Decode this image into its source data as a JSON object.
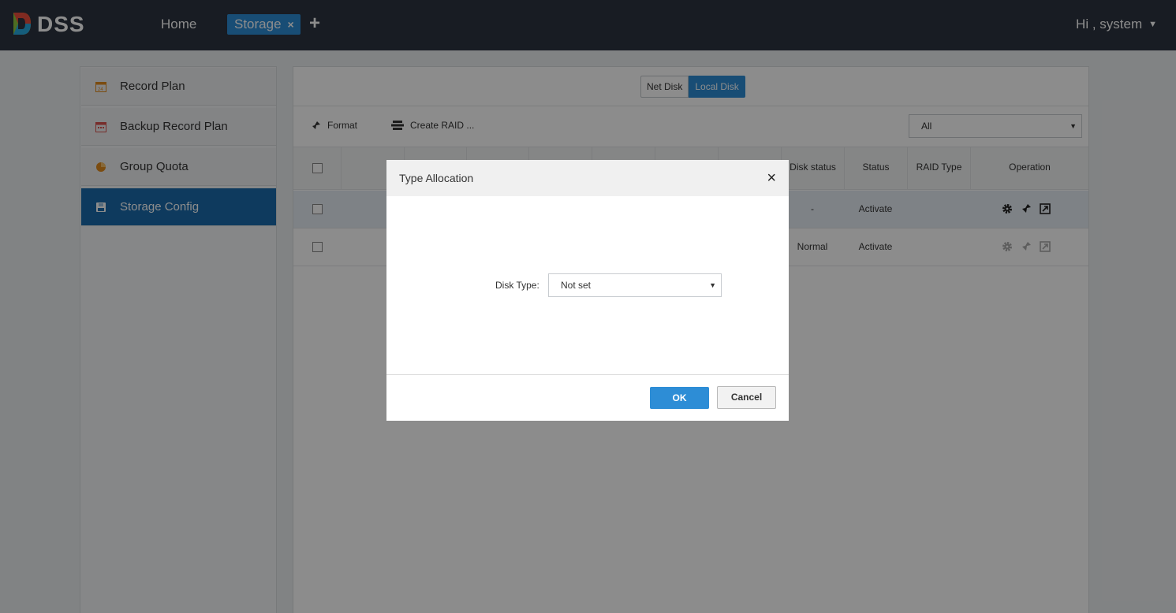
{
  "header": {
    "brand": "DSS",
    "tabs": {
      "home": "Home",
      "storage": "Storage"
    },
    "close_tab_glyph": "×",
    "add_tab_glyph": "+",
    "user_greeting": "Hi , system"
  },
  "sidebar": {
    "items": [
      {
        "label": "Record Plan",
        "icon": "calendar-24-icon"
      },
      {
        "label": "Backup Record Plan",
        "icon": "calendar-icon"
      },
      {
        "label": "Group Quota",
        "icon": "pie-chart-icon"
      },
      {
        "label": "Storage Config",
        "icon": "disk-icon",
        "active": true
      }
    ]
  },
  "main": {
    "disk_toggle": {
      "net": "Net Disk",
      "local": "Local Disk",
      "selected": "Local Disk"
    },
    "toolbar": {
      "format": "Format",
      "create_raid": "Create RAID ..."
    },
    "filter": {
      "value": "All"
    },
    "table": {
      "columns": [
        "",
        "",
        "",
        "",
        "",
        "",
        "",
        "",
        "Disk status",
        "Status",
        "RAID Type",
        "Operation"
      ],
      "rows": [
        {
          "disk_status": "-",
          "status": "Activate",
          "raid_type": "",
          "selected": true
        },
        {
          "disk_status": "Normal",
          "status": "Activate",
          "raid_type": "",
          "selected": false
        }
      ]
    }
  },
  "dialog": {
    "title": "Type Allocation",
    "close_glyph": "×",
    "disk_type_label": "Disk Type:",
    "disk_type_value": "Not set",
    "ok": "OK",
    "cancel": "Cancel"
  },
  "colors": {
    "topbar": "#2c3440",
    "accent": "#2d8dd6",
    "sidebar_active": "#1a6bab"
  }
}
